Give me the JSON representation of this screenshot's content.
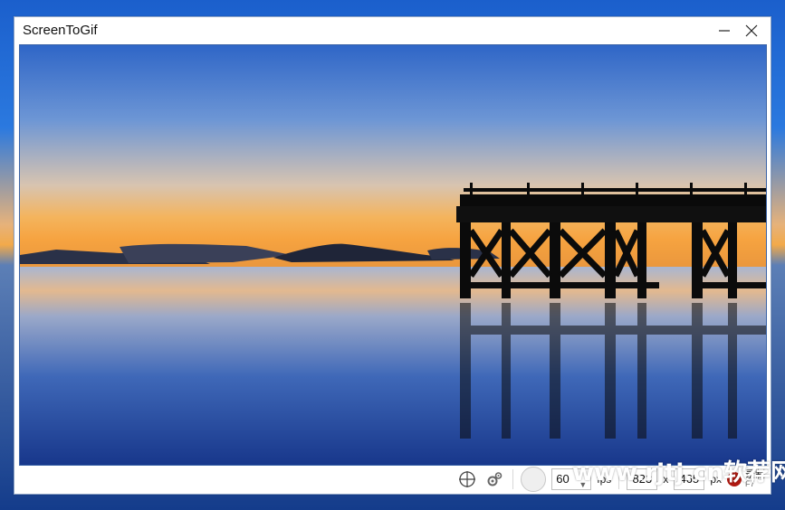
{
  "window": {
    "title": "ScreenToGif"
  },
  "toolbar": {
    "fps_value": "60",
    "fps_label": "fps",
    "width_value": "823",
    "times_label": "x",
    "height_value": "465",
    "unit_label": "px",
    "record_label": "录制",
    "record_shortcut": "F7"
  },
  "watermark": {
    "text": "www.rjtj.cn软荐网"
  },
  "icons": {
    "minimize": "minimize-icon",
    "close": "close-icon",
    "crosshair": "crosshair-icon",
    "settings": "gears-icon",
    "record": "record-icon"
  },
  "colors": {
    "accent": "#3b64a7",
    "record": "#b01a12"
  }
}
